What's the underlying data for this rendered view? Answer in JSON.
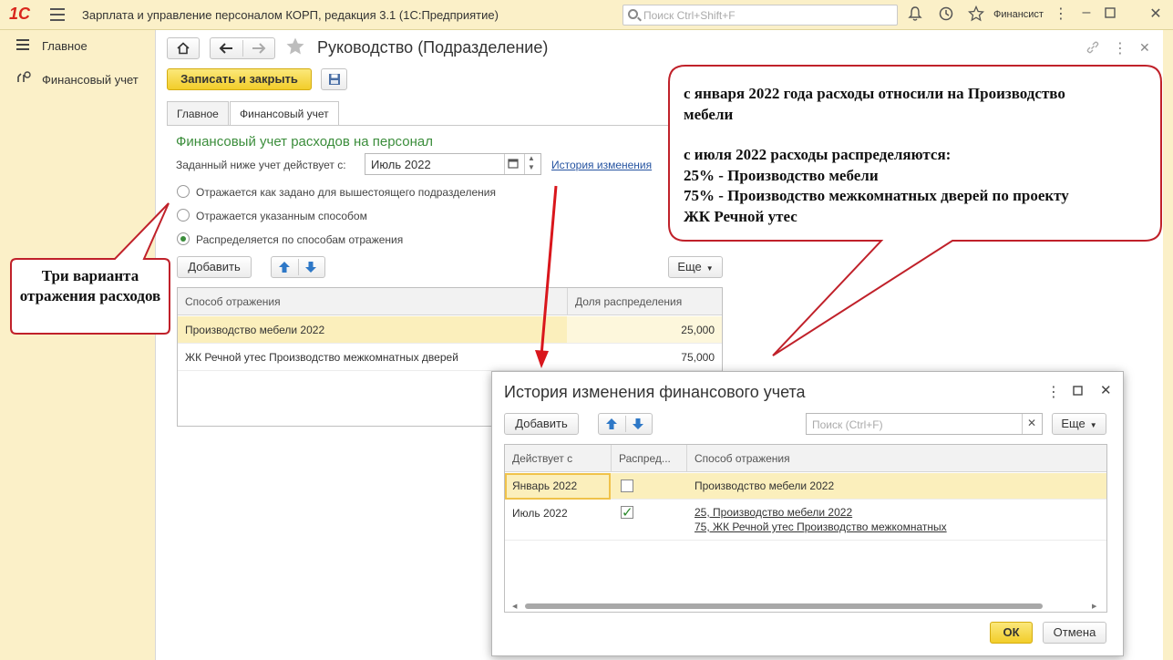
{
  "app": {
    "logo": "1С",
    "title": "Зарплата и управление персоналом КОРП, редакция 3.1  (1С:Предприятие)",
    "search_placeholder": "Поиск Ctrl+Shift+F",
    "user": "Финансист"
  },
  "nav": {
    "items": [
      {
        "label": "Главное",
        "icon": "menu-lines-icon"
      },
      {
        "label": "Финансовый учет",
        "icon": "finance-icon"
      }
    ]
  },
  "form": {
    "title": "Руководство (Подразделение)",
    "save_close_label": "Записать и закрыть",
    "tabs": [
      {
        "label": "Главное",
        "active": false
      },
      {
        "label": "Финансовый учет",
        "active": true
      }
    ],
    "section_title": "Финансовый учет расходов на персонал",
    "effective_label": "Заданный ниже учет действует с:",
    "effective_value": "Июль 2022",
    "history_link": "История изменения",
    "radios": [
      {
        "label": "Отражается как задано для вышестоящего подразделения",
        "checked": false
      },
      {
        "label": "Отражается указанным способом",
        "checked": false
      },
      {
        "label": "Распределяется по способам отражения",
        "checked": true
      }
    ],
    "add_label": "Добавить",
    "more_label": "Еще",
    "table": {
      "columns": [
        "Способ отражения",
        "Доля распределения"
      ],
      "rows": [
        {
          "method": "Производство мебели 2022",
          "share": "25,000",
          "selected": true
        },
        {
          "method": "ЖК Речной утес Производство межкомнатных дверей",
          "share": "75,000",
          "selected": false
        }
      ]
    }
  },
  "callouts": {
    "left": "Три варианта отражения расходов",
    "right_lines": [
      "с января 2022 года расходы относили на Производство",
      "мебели",
      "",
      "с июля 2022 расходы распределяются:",
      "25% - Производство мебели",
      "75% - Производство межкомнатных дверей по проекту",
      "ЖК Речной утес"
    ]
  },
  "dialog": {
    "title": "История изменения финансового учета",
    "add_label": "Добавить",
    "search_placeholder": "Поиск (Ctrl+F)",
    "more_label": "Еще",
    "columns": [
      "Действует с",
      "Распред...",
      "Способ отражения"
    ],
    "rows": [
      {
        "date": "Январь 2022",
        "distributed": false,
        "methods": [
          "Производство мебели 2022"
        ]
      },
      {
        "date": "Июль 2022",
        "distributed": true,
        "methods": [
          "25, Производство мебели 2022",
          "75, ЖК Речной утес Производство межкомнатных"
        ]
      }
    ],
    "ok_label": "ОК",
    "cancel_label": "Отмена"
  },
  "colors": {
    "accent_yellow": "#f2cd2a",
    "section_green": "#3b8d3b",
    "callout_border": "#c0212a",
    "arrow_red": "#d9161c"
  }
}
